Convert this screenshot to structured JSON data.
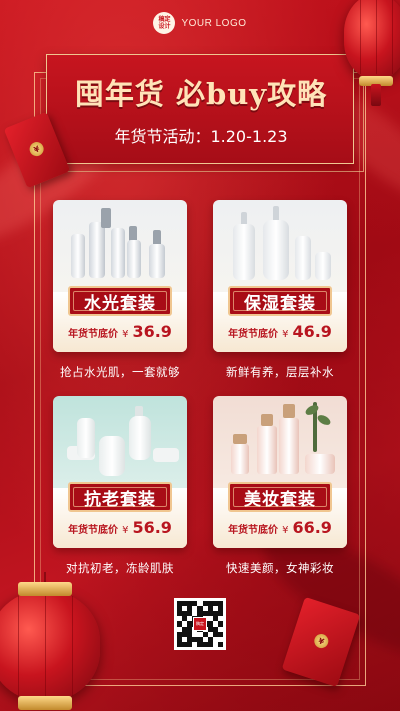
{
  "logo": {
    "badge_line1": "稿定",
    "badge_line2": "设计",
    "text": "YOUR LOGO"
  },
  "header": {
    "title": "囤年货 必buy攻略",
    "subtitle": "年货节活动：1.20-1.23"
  },
  "envelope_seal": "¥",
  "products": [
    {
      "name": "水光套装",
      "price_label": "年货节底价",
      "currency": "¥",
      "price": "36.9",
      "desc": "抢占水光肌，一套就够"
    },
    {
      "name": "保湿套装",
      "price_label": "年货节底价",
      "currency": "¥",
      "price": "46.9",
      "desc": "新鲜有养，层层补水"
    },
    {
      "name": "抗老套装",
      "price_label": "年货节底价",
      "currency": "¥",
      "price": "56.9",
      "desc": "对抗初老，冻龄肌肤"
    },
    {
      "name": "美妆套装",
      "price_label": "年货节底价",
      "currency": "¥",
      "price": "66.9",
      "desc": "快速美颜，女神彩妆"
    }
  ],
  "qr": {
    "center_label": "稿定"
  },
  "colors": {
    "primary_red": "#c8141e",
    "gold": "#f0c690",
    "price_red": "#b8151f"
  }
}
